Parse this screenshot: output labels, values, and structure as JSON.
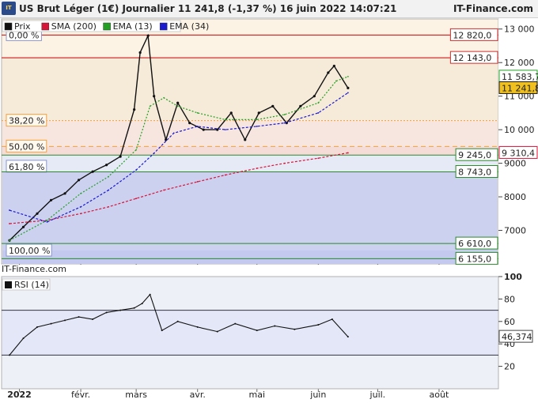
{
  "header": {
    "logo_text": "IT",
    "title": "US Brut Léger (1€) Journalier 11 241,8 (-1,37 %) 16 juin 2022 14:07:21",
    "brand": "IT-Finance.com"
  },
  "colors": {
    "price": "#111111",
    "sma": "#d8143a",
    "ema13": "#22a022",
    "ema34": "#1a1ad0",
    "fib_line_red": "#d03030",
    "fib_line_green": "#2a8a2a",
    "fib_text_orange": "#f0a040"
  },
  "chart_data": [
    {
      "type": "line",
      "title": "",
      "legend": [
        "Prix",
        "SMA (200)",
        "EMA (13)",
        "EMA (34)"
      ],
      "x_ticks": [
        "2022",
        "févr.",
        "mars",
        "avr.",
        "mai",
        "juin",
        "juil.",
        "août"
      ],
      "y_ticks": [
        "7000",
        "8000",
        "9000",
        "10 000",
        "11 000",
        "12 000",
        "13 000"
      ],
      "ylim": [
        6000,
        13300
      ],
      "price_labels": [
        {
          "text": "11 583,7",
          "value": 11583.7
        },
        {
          "text": "11 241,8",
          "value": 11241.8
        },
        {
          "text": "9 310,4",
          "value": 9310.4
        }
      ],
      "fibonacci": [
        {
          "pct": "0,00 %",
          "value": 12820,
          "label": "12 820,0"
        },
        {
          "pct": "",
          "value": 12143,
          "label": "12 143,0"
        },
        {
          "pct": "38,20 %",
          "value": 10270,
          "label": ""
        },
        {
          "pct": "50,00 %",
          "value": 9500,
          "label": ""
        },
        {
          "pct": "",
          "value": 9245,
          "label": "9 245,0"
        },
        {
          "pct": "61,80 %",
          "value": 8900,
          "label": ""
        },
        {
          "pct": "",
          "value": 8743,
          "label": "8 743,0"
        },
        {
          "pct": "",
          "value": 6610,
          "label": "6 610,0"
        },
        {
          "pct": "100,00 %",
          "value": 6400,
          "label": ""
        },
        {
          "pct": "",
          "value": 6155,
          "label": "6 155,0"
        }
      ],
      "series": [
        {
          "name": "Prix",
          "dates": [
            "2021-12-27",
            "2022-01-03",
            "2022-01-10",
            "2022-01-17",
            "2022-01-24",
            "2022-01-31",
            "2022-02-07",
            "2022-02-14",
            "2022-02-21",
            "2022-02-28",
            "2022-03-03",
            "2022-03-07",
            "2022-03-10",
            "2022-03-16",
            "2022-03-22",
            "2022-03-28",
            "2022-04-04",
            "2022-04-11",
            "2022-04-18",
            "2022-04-25",
            "2022-05-02",
            "2022-05-09",
            "2022-05-16",
            "2022-05-23",
            "2022-05-30",
            "2022-06-06",
            "2022-06-09",
            "2022-06-16"
          ],
          "values": [
            6700,
            7100,
            7500,
            7900,
            8100,
            8500,
            8750,
            8950,
            9200,
            10600,
            12300,
            12800,
            11000,
            9700,
            10800,
            10200,
            10000,
            10000,
            10500,
            9700,
            10500,
            10700,
            10200,
            10700,
            11000,
            11700,
            11900,
            11242
          ]
        },
        {
          "name": "SMA (200)",
          "dates": [
            "2021-12-27",
            "2022-01-15",
            "2022-02-01",
            "2022-02-15",
            "2022-03-01",
            "2022-03-15",
            "2022-04-01",
            "2022-04-15",
            "2022-05-01",
            "2022-05-15",
            "2022-06-01",
            "2022-06-16"
          ],
          "values": [
            7200,
            7300,
            7500,
            7700,
            7950,
            8200,
            8450,
            8650,
            8850,
            9000,
            9150,
            9310
          ]
        },
        {
          "name": "EMA (13)",
          "dates": [
            "2021-12-27",
            "2022-01-15",
            "2022-02-01",
            "2022-02-15",
            "2022-03-01",
            "2022-03-08",
            "2022-03-15",
            "2022-03-22",
            "2022-04-01",
            "2022-04-15",
            "2022-05-01",
            "2022-05-15",
            "2022-06-01",
            "2022-06-10",
            "2022-06-16"
          ],
          "values": [
            6700,
            7300,
            8100,
            8600,
            9400,
            10700,
            10950,
            10700,
            10500,
            10300,
            10300,
            10450,
            10800,
            11450,
            11584
          ]
        },
        {
          "name": "EMA (34)",
          "dates": [
            "2021-12-27",
            "2022-01-15",
            "2022-02-01",
            "2022-02-15",
            "2022-03-01",
            "2022-03-10",
            "2022-03-20",
            "2022-04-01",
            "2022-04-15",
            "2022-05-01",
            "2022-05-15",
            "2022-06-01",
            "2022-06-16"
          ],
          "values": [
            7600,
            7250,
            7700,
            8200,
            8800,
            9300,
            9900,
            10100,
            10000,
            10100,
            10200,
            10500,
            11100
          ]
        }
      ]
    },
    {
      "type": "line",
      "title": "",
      "legend": [
        "RSI (14)"
      ],
      "y_ticks": [
        "20",
        "40",
        "60",
        "80",
        "100"
      ],
      "ylim": [
        0,
        100
      ],
      "levels": [
        30,
        70
      ],
      "value_label": "46,374",
      "series": [
        {
          "name": "RSI (14)",
          "dates": [
            "2021-12-27",
            "2022-01-03",
            "2022-01-10",
            "2022-01-17",
            "2022-01-24",
            "2022-01-31",
            "2022-02-07",
            "2022-02-14",
            "2022-02-21",
            "2022-02-28",
            "2022-03-04",
            "2022-03-08",
            "2022-03-14",
            "2022-03-22",
            "2022-04-01",
            "2022-04-11",
            "2022-04-20",
            "2022-05-01",
            "2022-05-10",
            "2022-05-20",
            "2022-06-01",
            "2022-06-08",
            "2022-06-16"
          ],
          "values": [
            30,
            45,
            55,
            58,
            61,
            64,
            62,
            68,
            70,
            72,
            76,
            84,
            52,
            60,
            55,
            51,
            58,
            52,
            56,
            53,
            57,
            62,
            46.4
          ]
        }
      ]
    }
  ],
  "footer": {
    "source": "IT-Finance.com"
  }
}
